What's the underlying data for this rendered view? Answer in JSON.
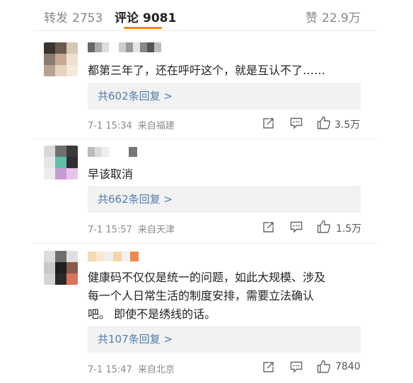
{
  "tabs": {
    "repost_label": "转发",
    "repost_count": "2753",
    "comment_label": "评论",
    "comment_count": "9081",
    "like_label": "赞",
    "like_count": "22.9万"
  },
  "colors": {
    "accent": "#ff8200",
    "link": "#507daf"
  },
  "comments": [
    {
      "text": "都第三年了，还在呼吁这个，就是互认不了……",
      "replies": "共602条回复 >",
      "time": "7-1 15:34",
      "source": "来自福建",
      "likes": "3.5万",
      "icons": [
        "repost-icon",
        "comment-icon",
        "like-icon"
      ]
    },
    {
      "text": "早该取消",
      "replies": "共662条回复 >",
      "time": "7-1 15:57",
      "source": "来自天津",
      "likes": "1.5万",
      "icons": [
        "repost-icon",
        "comment-icon",
        "like-icon"
      ]
    },
    {
      "text_lines": [
        "健康码不仅仅是统一的问题，如此大规模、涉及",
        "每一个人日常生活的制度安排，需要立法确认",
        "吧。 即使不是绣线的话。"
      ],
      "replies": "共107条回复 >",
      "time": "7-1 15:47",
      "source": "来自北京",
      "likes": "7840",
      "icons": [
        "repost-icon",
        "comment-icon",
        "like-icon"
      ]
    }
  ]
}
